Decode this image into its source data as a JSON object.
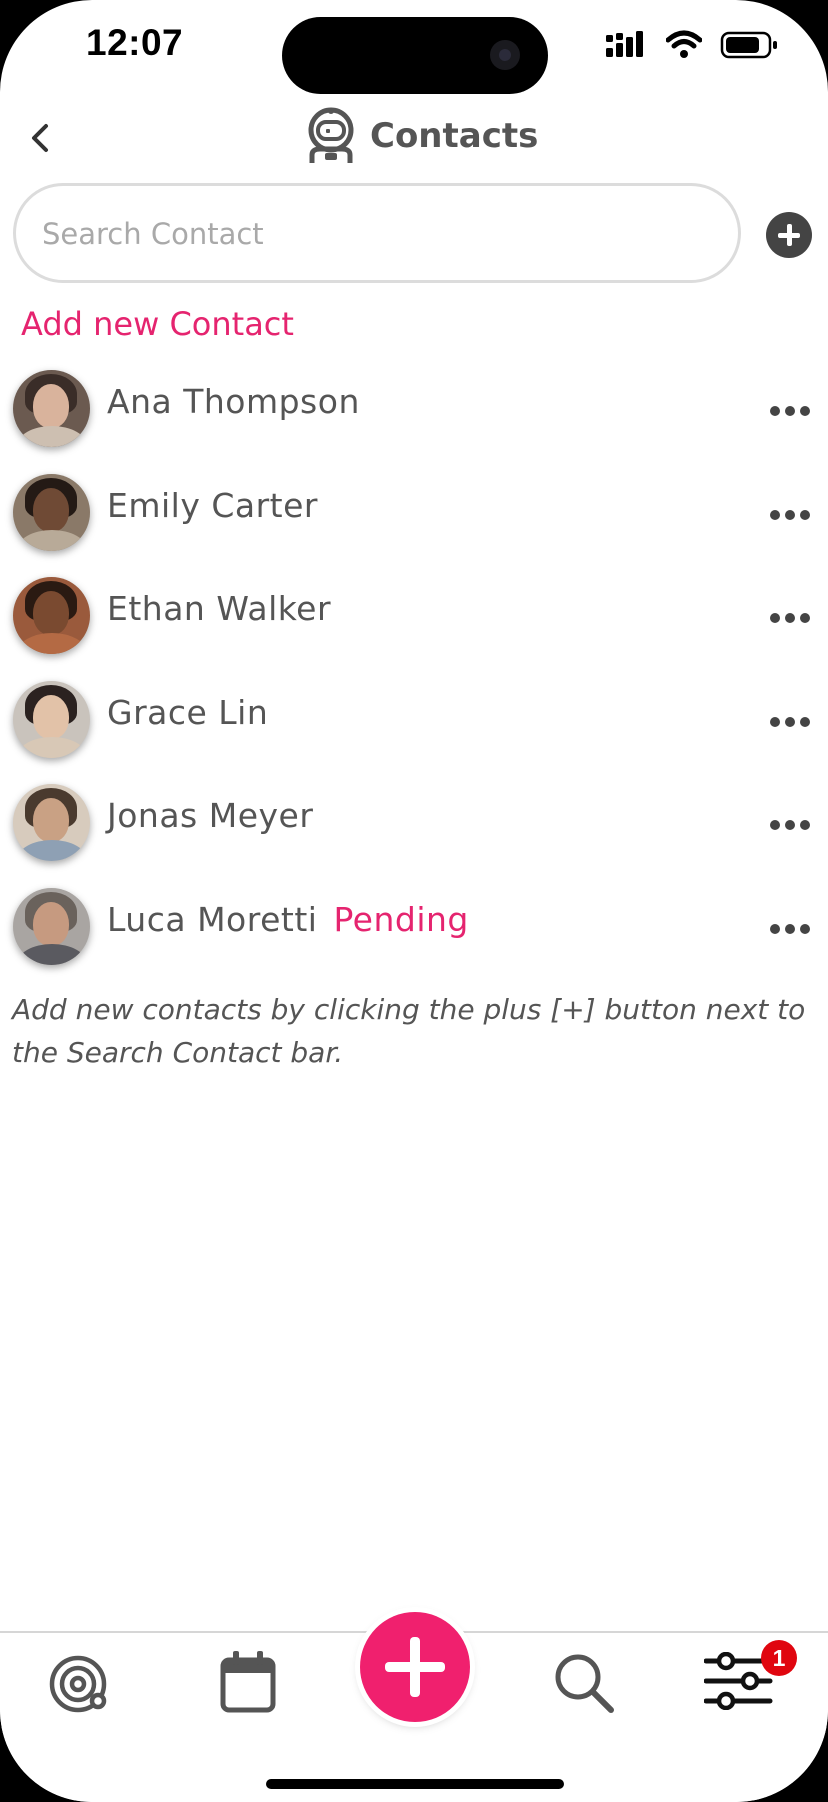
{
  "status_bar": {
    "time": "12:07"
  },
  "header": {
    "title": "Contacts"
  },
  "search": {
    "placeholder": "Search Contact",
    "value": ""
  },
  "add_new_link": "Add new Contact",
  "contacts": [
    {
      "name": "Ana Thompson",
      "status": ""
    },
    {
      "name": "Emily Carter",
      "status": ""
    },
    {
      "name": "Ethan Walker",
      "status": ""
    },
    {
      "name": "Grace Lin",
      "status": ""
    },
    {
      "name": "Jonas Meyer",
      "status": ""
    },
    {
      "name": "Luca Moretti",
      "status": "Pending"
    }
  ],
  "hint_text": "Add new contacts by clicking the plus [+] button next to the Search Contact bar.",
  "bottom_nav": {
    "items": [
      "orbit-icon",
      "calendar-icon",
      "add-icon",
      "search-icon",
      "sliders-icon"
    ],
    "settings_badge": "1"
  },
  "colors": {
    "accent": "#e5246f",
    "fab": "#f0206e",
    "badge": "#e0060f",
    "text": "#555555"
  }
}
